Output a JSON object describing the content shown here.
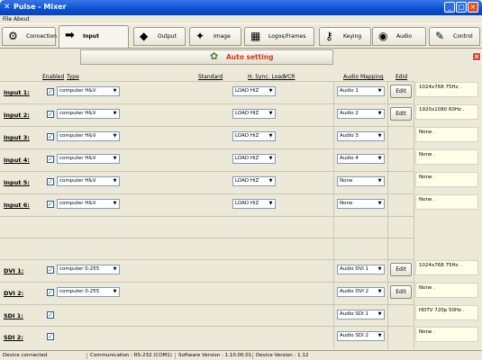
{
  "window": {
    "title": "Pulse - Mixer",
    "app_icon": "x-logo-icon",
    "min": "_",
    "max": "□",
    "close": "×"
  },
  "menu": {
    "items": [
      "File",
      "About"
    ]
  },
  "tabs": [
    {
      "label": "Connection",
      "icon": "gear-plug-icon",
      "glyph": "⚙"
    },
    {
      "label": "Input",
      "icon": "input-arrow-icon",
      "glyph": "➡"
    },
    {
      "label": "Output",
      "icon": "output-cube-icon",
      "glyph": "◆"
    },
    {
      "label": "Image",
      "icon": "image-star-icon",
      "glyph": "✦"
    },
    {
      "label": "Logos/Frames",
      "icon": "frame-icon",
      "glyph": "▦"
    },
    {
      "label": "Keying",
      "icon": "key-icon",
      "glyph": "⚷"
    },
    {
      "label": "Audio",
      "icon": "speaker-icon",
      "glyph": "◉"
    },
    {
      "label": "Control",
      "icon": "pen-icon",
      "glyph": "✎"
    }
  ],
  "active_tab": "Input",
  "panel_close": "×",
  "auto_setting": {
    "label": "Auto setting",
    "icon": "wand-icon",
    "glyph": "✿"
  },
  "headers": {
    "enabled": "Enabled",
    "type": "Type",
    "standard": "Standard",
    "hsync": "H. Sync. Load",
    "vcr": "VCR",
    "audio": "Audio Mapping",
    "edid": "Edid"
  },
  "check_mark": "✓",
  "dropdown_arrow": "▼",
  "edit_label": "Edit",
  "rows": [
    {
      "label": "Input 1:",
      "type": "computer H&V",
      "hsync": "LOAD HiZ",
      "audio": "Audio 1",
      "edit": true,
      "result": "1024x768 75Hz ."
    },
    {
      "label": "Input 2:",
      "type": "computer H&V",
      "hsync": "LOAD HiZ",
      "audio": "Audio 2",
      "edit": true,
      "result": "1920x1080 60Hz ."
    },
    {
      "label": "Input 3:",
      "type": "computer H&V",
      "hsync": "LOAD HiZ",
      "audio": "Audio 3",
      "edit": false,
      "result": "None ."
    },
    {
      "label": "Input 4:",
      "type": "computer H&V",
      "hsync": "LOAD HiZ",
      "audio": "Audio 4",
      "edit": false,
      "result": "None ."
    },
    {
      "label": "Input 5:",
      "type": "computer H&V",
      "hsync": "LOAD HiZ",
      "audio": "None",
      "edit": false,
      "result": "None ."
    },
    {
      "label": "Input 6:",
      "type": "computer H&V",
      "hsync": "LOAD HiZ",
      "audio": "None",
      "edit": false,
      "result": "None ."
    }
  ],
  "dvi_rows": [
    {
      "label": "DVI 1:",
      "type": "computer 0-255",
      "audio": "Audio DVI 1",
      "edit": true,
      "result": "1024x768 75Hz ."
    },
    {
      "label": "DVI 2:",
      "type": "computer 0-255",
      "audio": "Audio DVI 2",
      "edit": true,
      "result": "None ."
    },
    {
      "label": "SDI 1:",
      "type": "",
      "audio": "Audio SDI 1",
      "edit": false,
      "result": "HDTV 720p 50Hz ."
    },
    {
      "label": "SDI 2:",
      "type": "",
      "audio": "Audio SDI 2",
      "edit": false,
      "result": "None ."
    }
  ],
  "status": {
    "connection": "Device connected",
    "communication": "Communication : RS-232 (COM1)",
    "software": "Software Version : 1.10.00.01",
    "device": "Device Version : 1.12"
  }
}
